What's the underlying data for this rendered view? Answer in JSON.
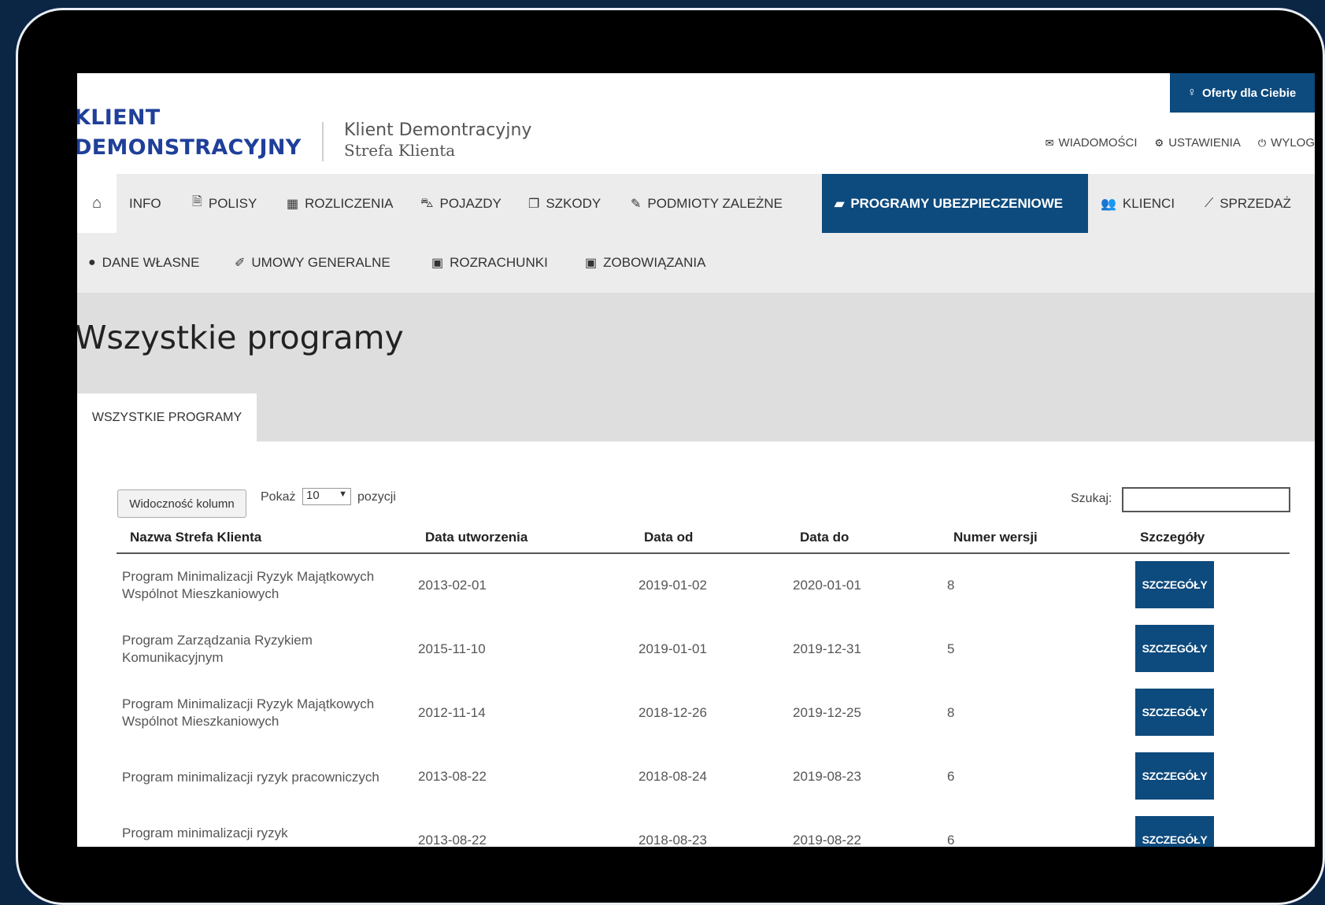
{
  "brand": {
    "line1": "KLIENT",
    "line2": "DEMONSTRACYJNY"
  },
  "client": {
    "name": "Klient Demontracyjny",
    "zone": "Strefa Klienta"
  },
  "header": {
    "offers_label": "Oferty dla Ciebie",
    "messages_label": "WIADOMOŚCI",
    "settings_label": "USTAWIENIA",
    "logout_label": "WYLOG"
  },
  "nav_row1": [
    {
      "icon": "home-icon",
      "label": ""
    },
    {
      "icon": "none",
      "label": "INFO"
    },
    {
      "icon": "document-icon",
      "label": "POLISY"
    },
    {
      "icon": "calendar-icon",
      "label": "ROZLICZENIA"
    },
    {
      "icon": "car-icon",
      "label": "POJAZDY"
    },
    {
      "icon": "copy-icon",
      "label": "SZKODY"
    },
    {
      "icon": "pencil-icon",
      "label": "PODMIOTY ZALEŻNE"
    },
    {
      "icon": "book-icon",
      "label": "PROGRAMY UBEZPIECZENIOWE"
    },
    {
      "icon": "users-icon",
      "label": "KLIENCI"
    },
    {
      "icon": "chart-icon",
      "label": "SPRZEDAŻ"
    }
  ],
  "nav_row2": [
    {
      "icon": "user-icon",
      "label": "DANE WŁASNE"
    },
    {
      "icon": "edit-icon",
      "label": "UMOWY GENERALNE"
    },
    {
      "icon": "money-icon",
      "label": "ROZRACHUNKI"
    },
    {
      "icon": "money-icon",
      "label": "ZOBOWIĄZANIA"
    }
  ],
  "page_title": "Wszystkie programy",
  "tab_label": "WSZYSTKIE PROGRAMY",
  "controls": {
    "columns_button": "Widoczność kolumn",
    "show_label": "Pokaż",
    "page_size": "10",
    "entries_label": "pozycji",
    "search_label": "Szukaj:",
    "search_value": ""
  },
  "table": {
    "headers": [
      "Nazwa Strefa Klienta",
      "Data utworzenia",
      "Data od",
      "Data do",
      "Numer wersji",
      "Szczegóły"
    ],
    "rows": [
      {
        "name": "Program Minimalizacji Ryzyk Majątkowych Wspólnot Mieszkaniowych",
        "created": "2013-02-01",
        "from": "2019-01-02",
        "to": "2020-01-01",
        "version": "8",
        "details": "SZCZEGÓŁY"
      },
      {
        "name": "Program Zarządzania Ryzykiem Komunikacyjnym",
        "created": "2015-11-10",
        "from": "2019-01-01",
        "to": "2019-12-31",
        "version": "5",
        "details": "SZCZEGÓŁY"
      },
      {
        "name": "Program Minimalizacji Ryzyk Majątkowych Wspólnot Mieszkaniowych",
        "created": "2012-11-14",
        "from": "2018-12-26",
        "to": "2019-12-25",
        "version": "8",
        "details": "SZCZEGÓŁY"
      },
      {
        "name": "Program minimalizacji ryzyk pracowniczych",
        "created": "2013-08-22",
        "from": "2018-08-24",
        "to": "2019-08-23",
        "version": "6",
        "details": "SZCZEGÓŁY"
      },
      {
        "name": "Program minimalizacji ryzyk",
        "created": "2013-08-22",
        "from": "2018-08-23",
        "to": "2019-08-22",
        "version": "6",
        "details": "SZCZEGÓŁY"
      }
    ]
  },
  "colors": {
    "accent": "#0d4a7d",
    "brand": "#1f3f99",
    "background": "#0b2545"
  }
}
